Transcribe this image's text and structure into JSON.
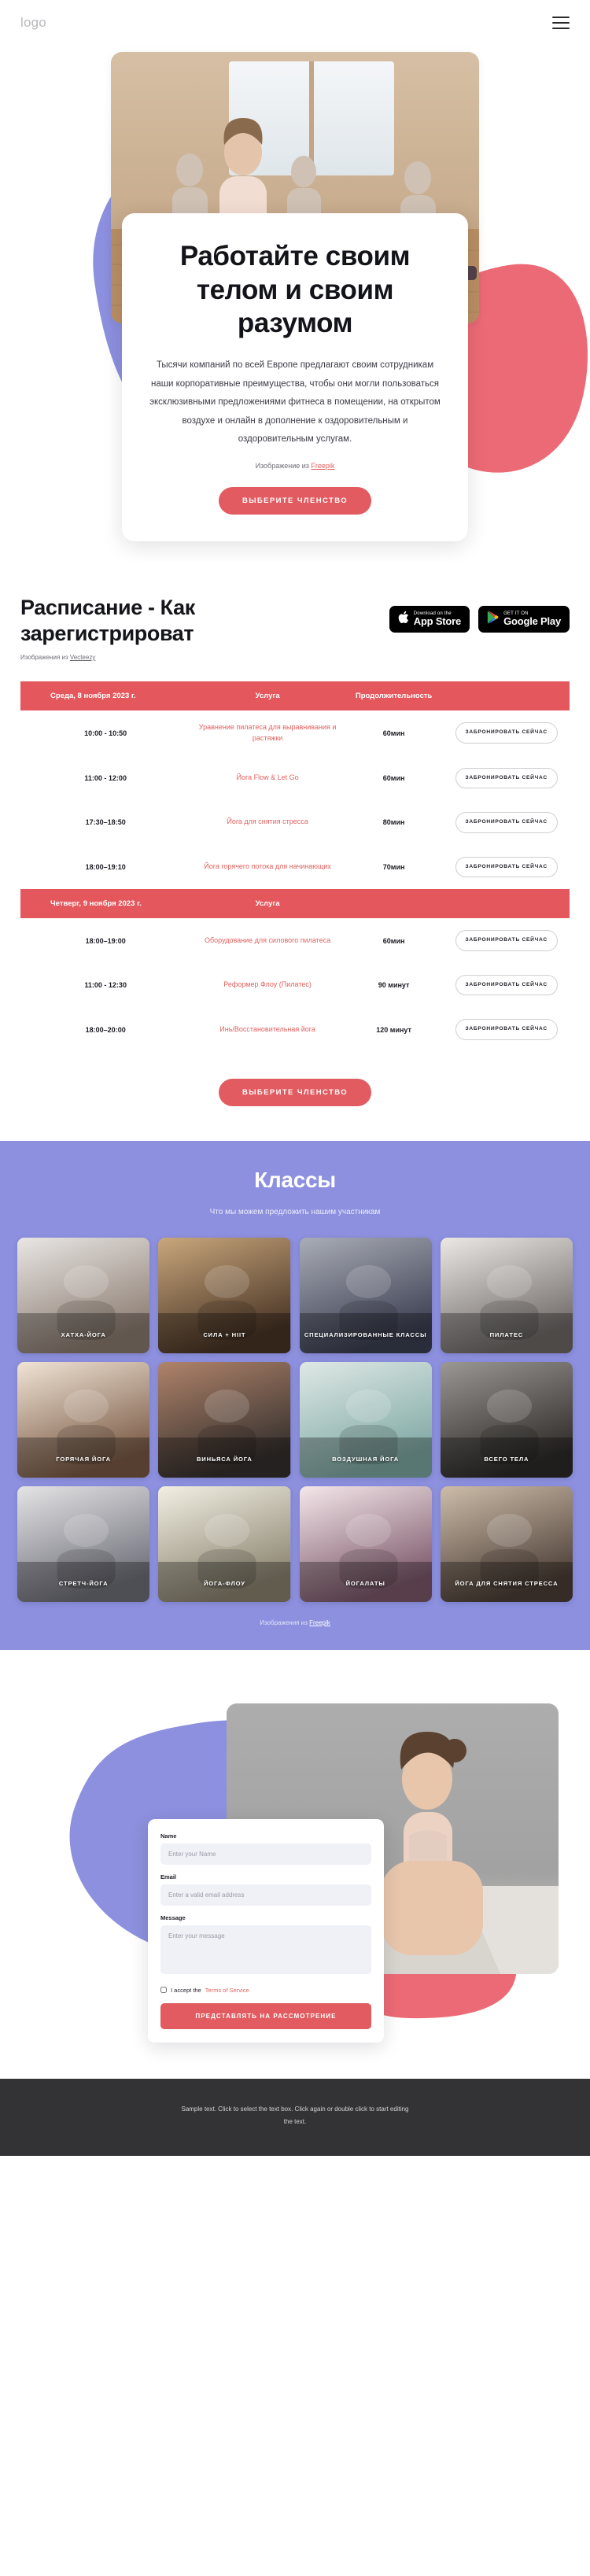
{
  "header": {
    "logo": "logo",
    "menu_icon": "hamburger-icon"
  },
  "hero": {
    "title": "Работайте своим телом и своим разумом",
    "description": "Тысячи компаний по всей Европе предлагают своим сотрудникам наши корпоративные преимущества, чтобы они могли пользоваться эксклюзивными предложениями фитнеса в помещении, на открытом воздухе и онлайн в дополнение к оздоровительным и оздоровительным услугам.",
    "credit_prefix": "Изображение из ",
    "credit_link": "Freepik",
    "cta": "ВЫБЕРИТЕ ЧЛЕНСТВО"
  },
  "schedule": {
    "heading": "Расписание - Как зарегистрироват",
    "credit_prefix": "Изображения из ",
    "credit_link": "Vecteezy",
    "store_badges": [
      {
        "small": "Download on the",
        "big": "App Store",
        "icon": "apple-icon"
      },
      {
        "small": "GET IT ON",
        "big": "Google Play",
        "icon": "google-play-icon"
      }
    ],
    "columns": {
      "service": "Услуга",
      "duration": "Продолжительность"
    },
    "days": [
      {
        "label": "Среда, 8 ноября 2023 г.",
        "show_duration_header": true,
        "rows": [
          {
            "time": "10:00 - 10:50",
            "service": "Уравнение пилатеса для выравнивания и растяжки",
            "duration": "60мин",
            "book": "ЗАБРОНИРОВАТЬ СЕЙЧАС"
          },
          {
            "time": "11:00 - 12:00",
            "service": "Йога Flow & Let Go",
            "duration": "60мин",
            "book": "ЗАБРОНИРОВАТЬ СЕЙЧАС"
          },
          {
            "time": "17:30–18:50",
            "service": "Йога для снятия стресса",
            "duration": "80мин",
            "book": "ЗАБРОНИРОВАТЬ СЕЙЧАС"
          },
          {
            "time": "18:00–19:10",
            "service": "Йога горячего потока для начинающих",
            "duration": "70мин",
            "book": "ЗАБРОНИРОВАТЬ СЕЙЧАС"
          }
        ]
      },
      {
        "label": "Четверг, 9 ноября 2023 г.",
        "show_duration_header": false,
        "rows": [
          {
            "time": "18:00–19:00",
            "service": "Оборудование для силового пилатеса",
            "duration": "60мин",
            "book": "ЗАБРОНИРОВАТЬ СЕЙЧАС"
          },
          {
            "time": "11:00 - 12:30",
            "service": "Реформер Флоу (Пилатес)",
            "duration": "90 минут",
            "book": "ЗАБРОНИРОВАТЬ СЕЙЧАС"
          },
          {
            "time": "18:00–20:00",
            "service": "Инь/Восстановительная йога",
            "duration": "120 минут",
            "book": "ЗАБРОНИРОВАТЬ СЕЙЧАС"
          }
        ]
      }
    ],
    "cta": "ВЫБЕРИТЕ ЧЛЕНСТВО"
  },
  "classes": {
    "title": "Классы",
    "subtitle": "Что мы можем предложить нашим участникам",
    "credit_prefix": "Изображения из ",
    "credit_link": "Freepik",
    "items": [
      {
        "label": "ХАТХА-ЙОГА",
        "c1": "#e8e6e4",
        "c2": "#8d7d72"
      },
      {
        "label": "СИЛА + HIIT",
        "c1": "#c9a77c",
        "c2": "#4a3526"
      },
      {
        "label": "СПЕЦИАЛИЗИРОВАННЫЕ КЛАССЫ",
        "c1": "#a9adb6",
        "c2": "#3c3f52"
      },
      {
        "label": "ПИЛАТЕС",
        "c1": "#ebe8e6",
        "c2": "#6f6a68"
      },
      {
        "label": "ГОРЯЧАЯ ЙОГА",
        "c1": "#f0e4d6",
        "c2": "#7b5b46"
      },
      {
        "label": "ВИНЬЯСА ЙОГА",
        "c1": "#b0836a",
        "c2": "#35302e"
      },
      {
        "label": "ВОЗДУШНАЯ ЙОГА",
        "c1": "#dfe8e6",
        "c2": "#7fa9a4"
      },
      {
        "label": "ВСЕГО ТЕЛА",
        "c1": "#9b9793",
        "c2": "#2f2c2a"
      },
      {
        "label": "СТРЕТЧ-ЙОГА",
        "c1": "#e4e4e6",
        "c2": "#70707a"
      },
      {
        "label": "ЙОГА-ФЛОУ",
        "c1": "#f2efe3",
        "c2": "#8b8470"
      },
      {
        "label": "ЙОГАЛАТЫ",
        "c1": "#f4e7ea",
        "c2": "#7e5a6c"
      },
      {
        "label": "ЙОГА ДЛЯ СНЯТИЯ СТРЕССА",
        "c1": "#cdbca9",
        "c2": "#4d4038"
      }
    ]
  },
  "contact": {
    "name_label": "Name",
    "name_placeholder": "Enter your Name",
    "email_label": "Email",
    "email_placeholder": "Enter a valid email address",
    "message_label": "Message",
    "message_placeholder": "Enter your message",
    "tos_prefix": "I accept the ",
    "tos_link": "Terms of Service",
    "submit": "ПРЕДСТАВЛЯТЬ НА РАССМОТРЕНИЕ"
  },
  "footer": {
    "text": "Sample text. Click to select the text box. Click again or double click to start editing the text."
  },
  "colors": {
    "accent_red": "#e15b60",
    "accent_purple": "#8c90de",
    "footer_bg": "#333336"
  }
}
